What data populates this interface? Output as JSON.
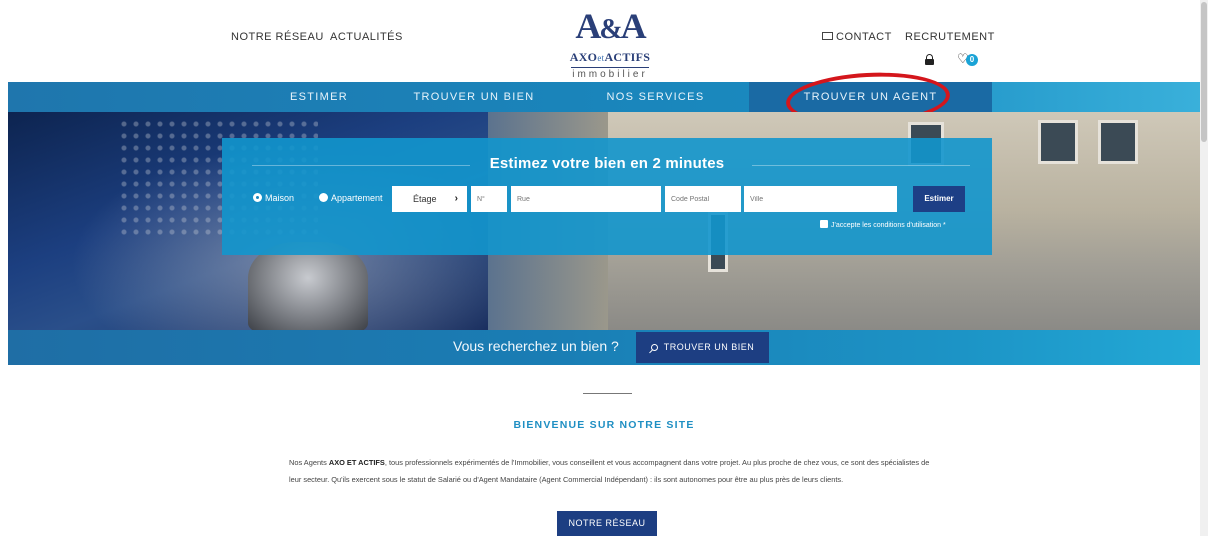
{
  "header": {
    "left_links": [
      "NOTRE RÉSEAU",
      "ACTUALITÉS"
    ],
    "contact_label": "CONTACT",
    "recruit_label": "RECRUTEMENT",
    "cart_count": "0",
    "logo": {
      "mark_a": "A",
      "mark_amp": "&",
      "mark_a2": "A",
      "brand_axo": "AXO",
      "brand_et": "et",
      "brand_actifs": "ACTIFS",
      "sub": "immobilier"
    }
  },
  "nav": {
    "items": [
      "ESTIMER",
      "TROUVER UN BIEN",
      "NOS SERVICES",
      "TROUVER UN AGENT"
    ],
    "active_index": 3
  },
  "estimate": {
    "title": "Estimez votre bien en 2 minutes",
    "radio_maison": "Maison",
    "radio_appartement": "Appartement",
    "etage_label": "Étage",
    "placeholder_num": "N°",
    "placeholder_rue": "Rue",
    "placeholder_cp": "Code Postal",
    "placeholder_ville": "Ville",
    "submit_label": "Estimer",
    "accept_label": "J'accepte les conditions d'utilisation *"
  },
  "search": {
    "question": "Vous recherchez un bien ?",
    "button_label": "TROUVER UN BIEN"
  },
  "welcome": {
    "title": "BIENVENUE SUR NOTRE SITE",
    "text_before": "Nos Agents ",
    "text_bold": "AXO ET ACTIFS",
    "text_after": ", tous professionnels expérimentés de l'Immobilier, vous conseillent et vous accompagnent dans votre projet. Au plus proche de chez vous, ce sont des spécialistes de leur secteur. Qu'ils exercent sous le statut de Salarié ou d'Agent Mandataire (Agent Commercial Indépendant) : ils sont autonomes pour être au plus près de leurs clients.",
    "button_label": "NOTRE RÉSEAU"
  },
  "colors": {
    "brand_navy": "#1d3e82",
    "brand_blue": "#1a86c0",
    "accent_cyan": "#1aa3d6",
    "highlight_red": "#d4161c"
  }
}
